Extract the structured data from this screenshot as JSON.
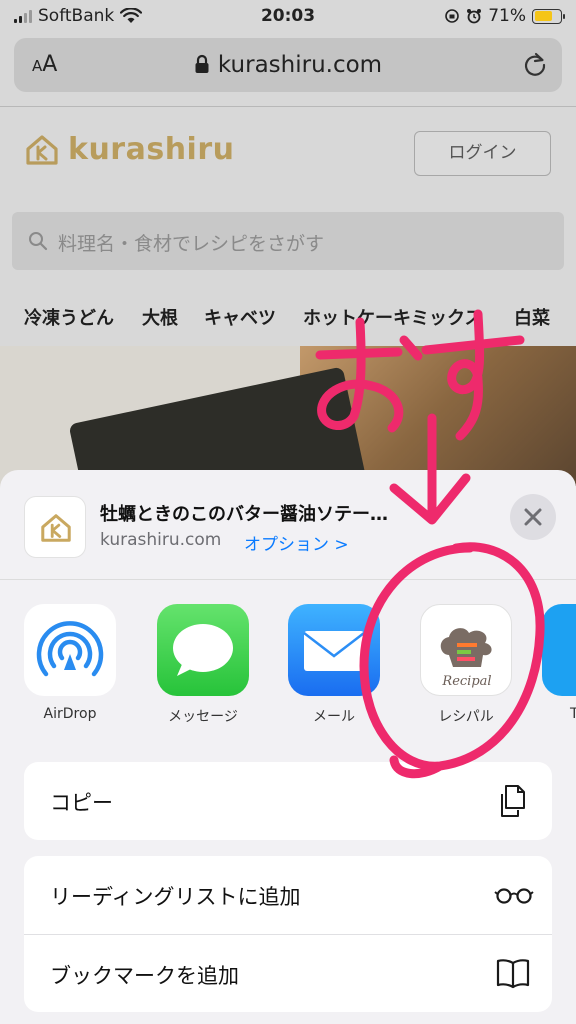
{
  "status": {
    "carrier": "SoftBank",
    "time": "20:03",
    "battery": "71%"
  },
  "browser": {
    "text_size": "AA",
    "url": "kurashiru.com"
  },
  "site": {
    "logo": "kurashiru",
    "login": "ログイン",
    "search_placeholder": "料理名・食材でレシピをさがす",
    "tags": [
      "冷凍うどん",
      "大根",
      "キャベツ",
      "ホットケーキミックス",
      "白菜"
    ]
  },
  "share": {
    "title": "牡蠣ときのこのバター醤油ソテー…",
    "domain": "kurashiru.com",
    "option": "オプション >",
    "apps": [
      {
        "label": "AirDrop",
        "icon": "airdrop-icon"
      },
      {
        "label": "メッセージ",
        "icon": "messages-icon"
      },
      {
        "label": "メール",
        "icon": "mail-icon"
      },
      {
        "label": "レシパル",
        "icon": "recipal-icon"
      },
      {
        "label": "T",
        "icon": "twitter-icon"
      }
    ],
    "actions": [
      {
        "label": "コピー",
        "icon": "copy-icon"
      },
      {
        "label": "リーディングリストに追加",
        "icon": "glasses-icon"
      },
      {
        "label": "ブックマークを追加",
        "icon": "book-icon"
      }
    ]
  },
  "annotation": {
    "text": "おす",
    "color": "#ee2a6c"
  },
  "colors": {
    "accent": "#0a7bff",
    "brand": "#b89c5c"
  }
}
